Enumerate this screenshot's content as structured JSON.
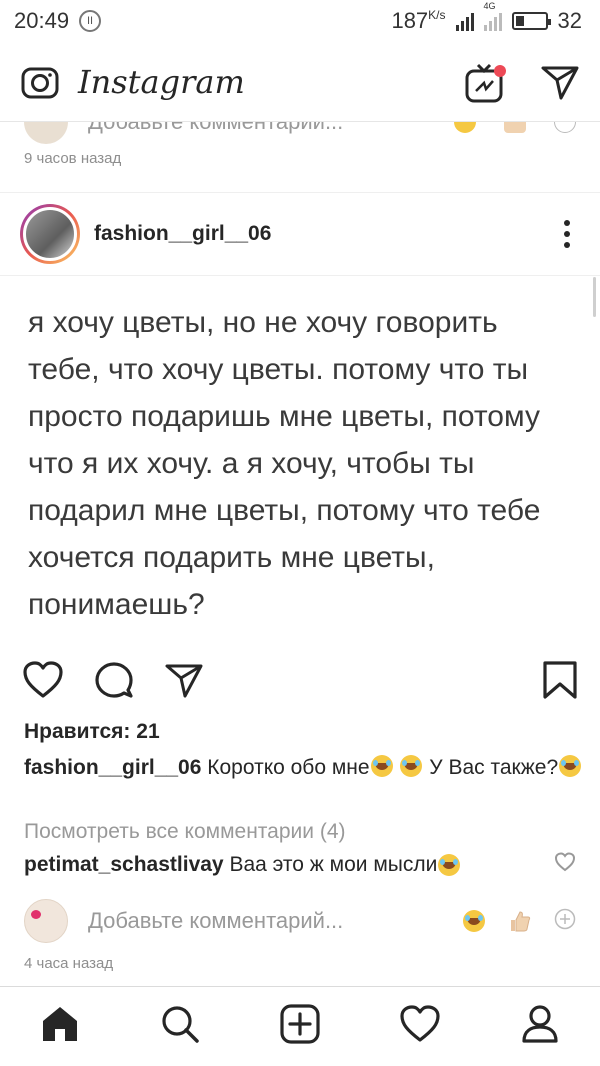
{
  "status_bar": {
    "time": "20:49",
    "pause_icon": "pause-circle-icon",
    "speed_value": "187",
    "speed_unit": "K/s",
    "network": "4G",
    "battery_level": "32"
  },
  "app_header": {
    "logo": "Instagram",
    "icons": [
      "camera-icon",
      "igtv-icon",
      "direct-send-icon"
    ],
    "notification_dot_color": "#ed4956"
  },
  "prev_post": {
    "add_comment_placeholder": "Добавьте комментарий...",
    "time": "9 часов назад"
  },
  "post": {
    "username": "fashion__girl__06",
    "quote": "я хочу цветы, но не хочу говорить тебе, что хочу цветы. потому что ты просто подаришь мне цветы, потому что я их хочу. а я хочу, чтобы ты подарил мне цветы, потому что тебе хочется подарить мне цветы, понимаешь?",
    "likes": "Нравится: 21",
    "caption_user": "fashion__girl__06",
    "caption_text_1": "Коротко обо мне",
    "caption_text_2": "У Вас",
    "caption_text_3": "также?",
    "view_all_comments": "Посмотреть все комментарии (4)",
    "comment_user": "petimat_schastlivay",
    "comment_text": "Ваа это ж мои мысли",
    "add_comment_placeholder": "Добавьте комментарий...",
    "timestamp": "4 часа назад"
  },
  "bottom_nav": [
    "home-icon",
    "search-icon",
    "add-post-icon",
    "activity-heart-icon",
    "profile-icon"
  ]
}
